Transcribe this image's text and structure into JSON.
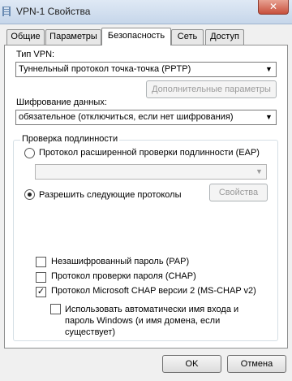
{
  "window": {
    "title": "VPN-1 Свойства",
    "close_glyph": "✕"
  },
  "tabs": [
    {
      "label": "Общие"
    },
    {
      "label": "Параметры"
    },
    {
      "label": "Безопасность"
    },
    {
      "label": "Сеть"
    },
    {
      "label": "Доступ"
    }
  ],
  "active_tab": "Безопасность",
  "security": {
    "vpn_type_label": "Тип VPN:",
    "vpn_type_value": "Туннельный протокол точка-точка (PPTP)",
    "advanced_button": "Дополнительные параметры",
    "encryption_label": "Шифрование данных:",
    "encryption_value": "обязательное (отключиться, если нет шифрования)",
    "auth_group_title": "Проверка подлинности",
    "eap_radio_label": "Протокол расширенной проверки подлинности (EAP)",
    "eap_selected": false,
    "eap_select_value": "",
    "allow_radio_label": "Разрешить следующие протоколы",
    "allow_selected": true,
    "properties_button": "Свойства",
    "protocols": [
      {
        "label": "Незашифрованный пароль (PAP)",
        "checked": false
      },
      {
        "label": "Протокол проверки пароля (CHAP)",
        "checked": false
      },
      {
        "label": "Протокол Microsoft CHAP версии 2 (MS-CHAP v2)",
        "checked": true
      }
    ],
    "auto_login": {
      "line1": "Использовать автоматически имя входа и",
      "line2": "пароль Windows (и имя домена, если",
      "line3": "существует)",
      "checked": false
    }
  },
  "footer": {
    "ok_label": "OK",
    "cancel_label": "Отмена"
  },
  "colors": {
    "title_bar": "#c6d6ea",
    "close_button": "#c7503c",
    "panel": "#ffffff"
  },
  "icons": {
    "dropdown": "chevron-down-icon",
    "app": "network-connection-icon"
  }
}
